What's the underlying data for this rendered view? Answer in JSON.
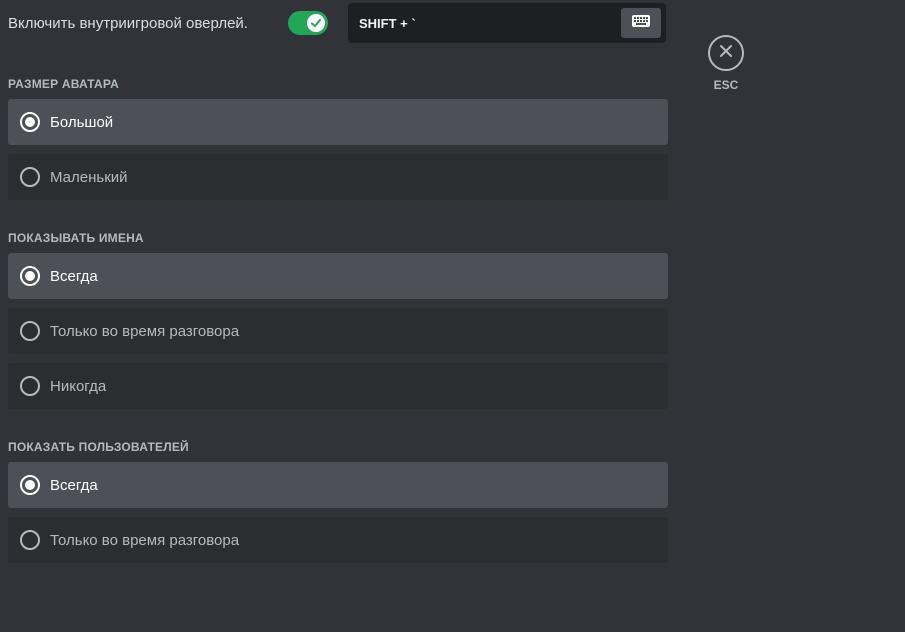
{
  "overlay": {
    "label": "Включить внутриигровой оверлей.",
    "enabled": true,
    "keybind": "SHIFT + `"
  },
  "esc": {
    "label": "ESC"
  },
  "avatar_size": {
    "title": "РАЗМЕР АВАТАРА",
    "options": [
      {
        "label": "Большой",
        "selected": true
      },
      {
        "label": "Маленький",
        "selected": false
      }
    ]
  },
  "show_names": {
    "title": "ПОКАЗЫВАТЬ ИМЕНА",
    "options": [
      {
        "label": "Всегда",
        "selected": true
      },
      {
        "label": "Только во время разговора",
        "selected": false
      },
      {
        "label": "Никогда",
        "selected": false
      }
    ]
  },
  "show_users": {
    "title": "ПОКАЗАТЬ ПОЛЬЗОВАТЕЛЕЙ",
    "options": [
      {
        "label": "Всегда",
        "selected": true
      },
      {
        "label": "Только во время разговора",
        "selected": false
      }
    ]
  }
}
